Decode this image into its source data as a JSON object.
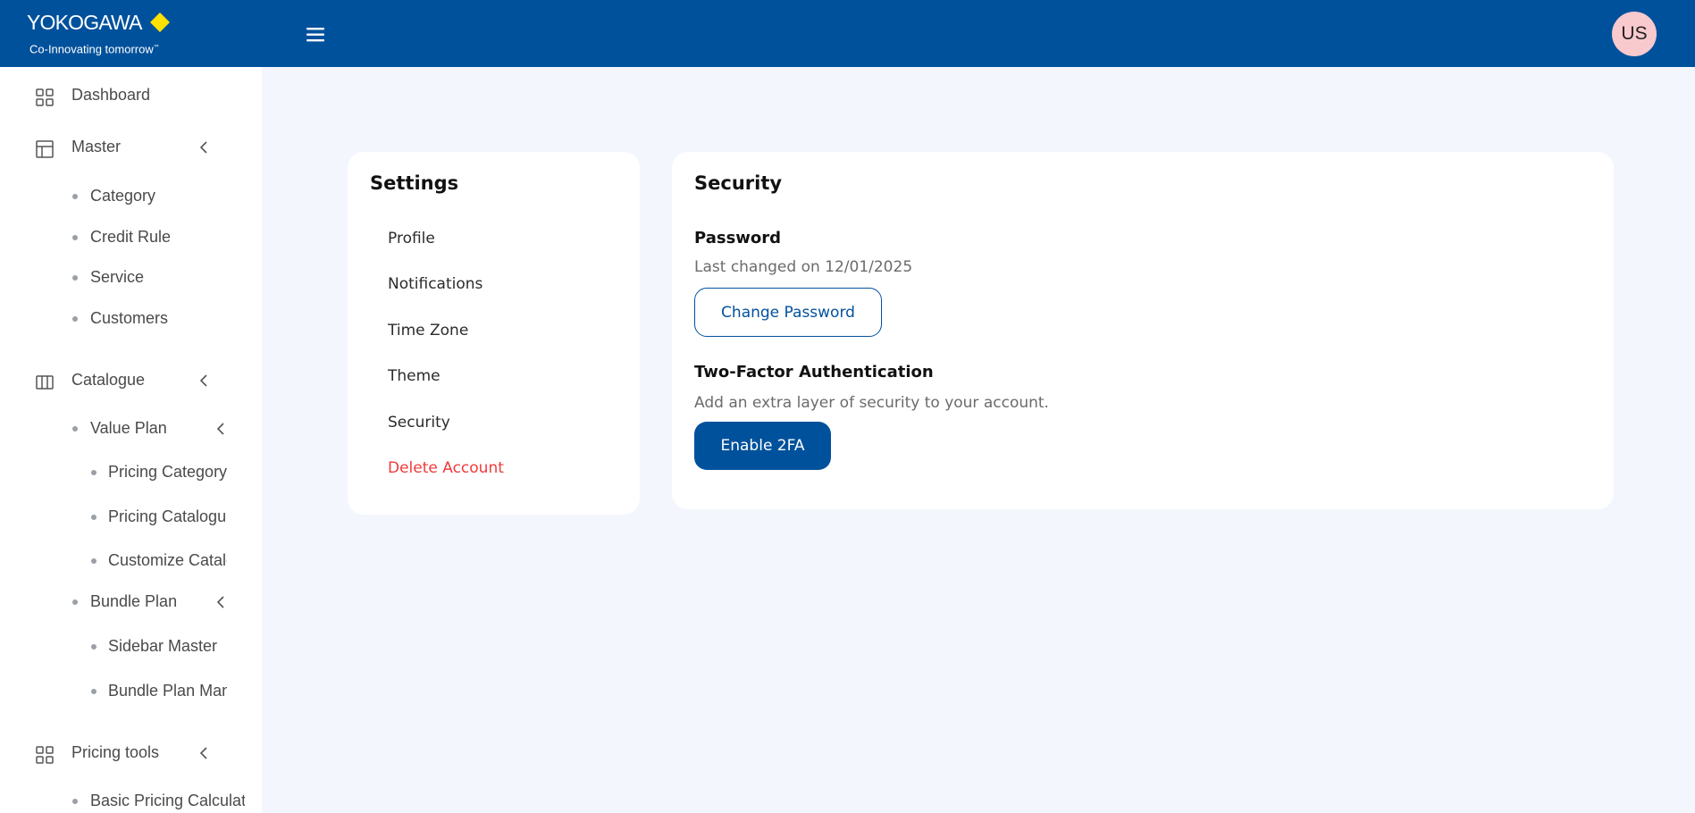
{
  "brand": {
    "name": "YOKOGAWA",
    "tagline": "Co-Innovating tomorrow",
    "trademark": "™",
    "accent_color": "#fde100",
    "header_color": "#00519c"
  },
  "header": {
    "avatar_initials": "US"
  },
  "sidebar": {
    "dashboard": "Dashboard",
    "master": {
      "label": "Master",
      "items": [
        "Category",
        "Credit Rule",
        "Service",
        "Customers"
      ]
    },
    "catalogue": {
      "label": "Catalogue",
      "value_plan": {
        "label": "Value Plan",
        "items": [
          "Pricing Category",
          "Pricing Catalogue",
          "Customize Catalogue"
        ]
      },
      "bundle_plan": {
        "label": "Bundle Plan",
        "items": [
          "Sidebar Master",
          "Bundle Plan Management"
        ]
      }
    },
    "pricing_tools": {
      "label": "Pricing tools",
      "items": [
        "Basic Pricing Calculator"
      ]
    }
  },
  "settings": {
    "title": "Settings",
    "menu": [
      "Profile",
      "Notifications",
      "Time Zone",
      "Theme",
      "Security",
      "Delete Account"
    ],
    "danger_color": "#ef3b3b"
  },
  "security": {
    "title": "Security",
    "password_label": "Password",
    "password_changed": "Last changed on 12/01/2025",
    "change_password_button": "Change Password",
    "twofa_label": "Two-Factor Authentication",
    "twofa_desc": "Add an extra layer of security to your account.",
    "enable_2fa_button": "Enable 2FA"
  }
}
